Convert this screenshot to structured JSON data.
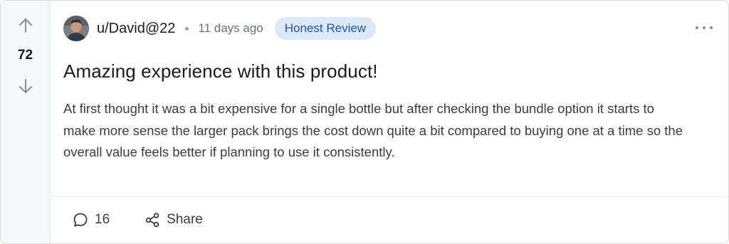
{
  "post": {
    "score": "72",
    "author": "u/David@22",
    "time": "11 days ago",
    "flair": "Honest Review",
    "title": "Amazing experience with this product!",
    "body": "At first thought it was a bit expensive for a single bottle but after checking the bundle option it starts to make more sense the larger pack brings the cost down quite a bit compared to buying one at a time so the overall value feels better if planning to use it consistently."
  },
  "actions": {
    "comments_count": "16",
    "share_label": "Share"
  },
  "colors": {
    "flair_bg": "#dbe9fb",
    "flair_text": "#1f56a8",
    "vote_column_bg": "#f7f8fa"
  },
  "icons": [
    "arrow-up-icon",
    "arrow-down-icon",
    "comment-icon",
    "share-icon",
    "more-options-icon"
  ]
}
